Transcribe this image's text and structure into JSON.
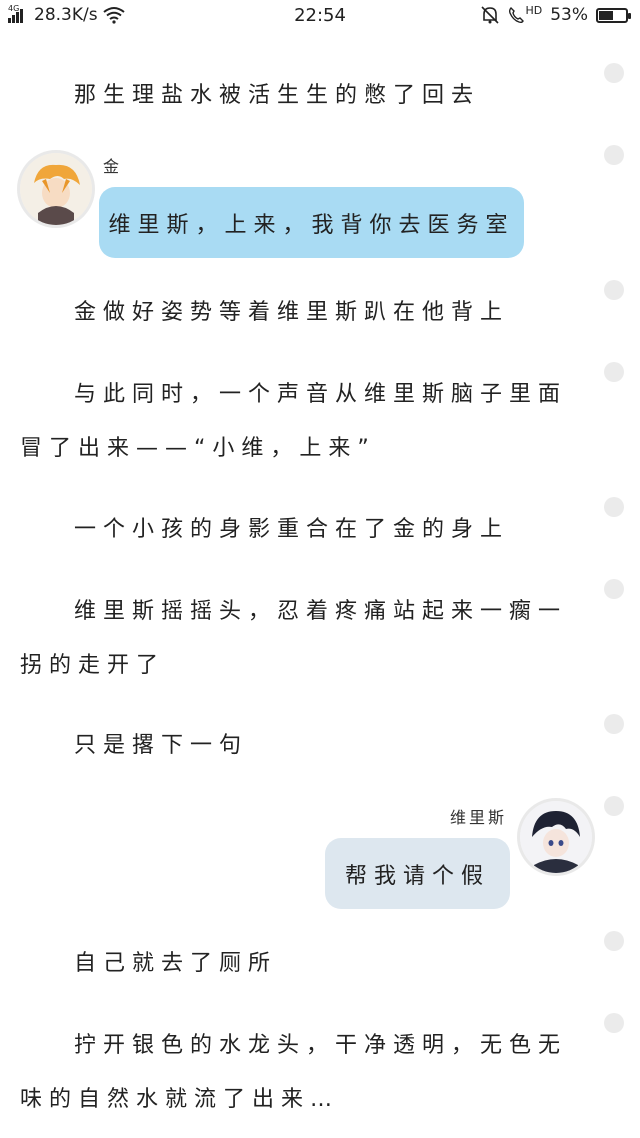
{
  "status_bar": {
    "network": "4G",
    "speed": "28.3K/s",
    "time": "22:54",
    "hd_label": "HD",
    "battery": "53%",
    "battery_level": 0.53
  },
  "story": {
    "p1": "那生理盐水被活生生的憋了回去",
    "msg1": {
      "speaker": "金",
      "text": "维里斯，上来，我背你去医务室"
    },
    "p2": "金做好姿势等着维里斯趴在他背上",
    "p3": "与此同时，一个声音从维里斯脑子里面冒了出来——“小维，上来”",
    "p4": "一个小孩的身影重合在了金的身上",
    "p5": "维里斯摇摇头，忍着疼痛站起来一瘸一拐的走开了",
    "p6": "只是撂下一句",
    "msg2": {
      "speaker": "维里斯",
      "text": "帮我请个假"
    },
    "p7": "自己就去了厕所",
    "p8": "拧开银色的水龙头，干净透明，无色无味的自然水就流了出来…"
  },
  "colors": {
    "bubble_left": "#a9dbf3",
    "bubble_right": "#dde7ef",
    "dot": "#ebebeb"
  }
}
